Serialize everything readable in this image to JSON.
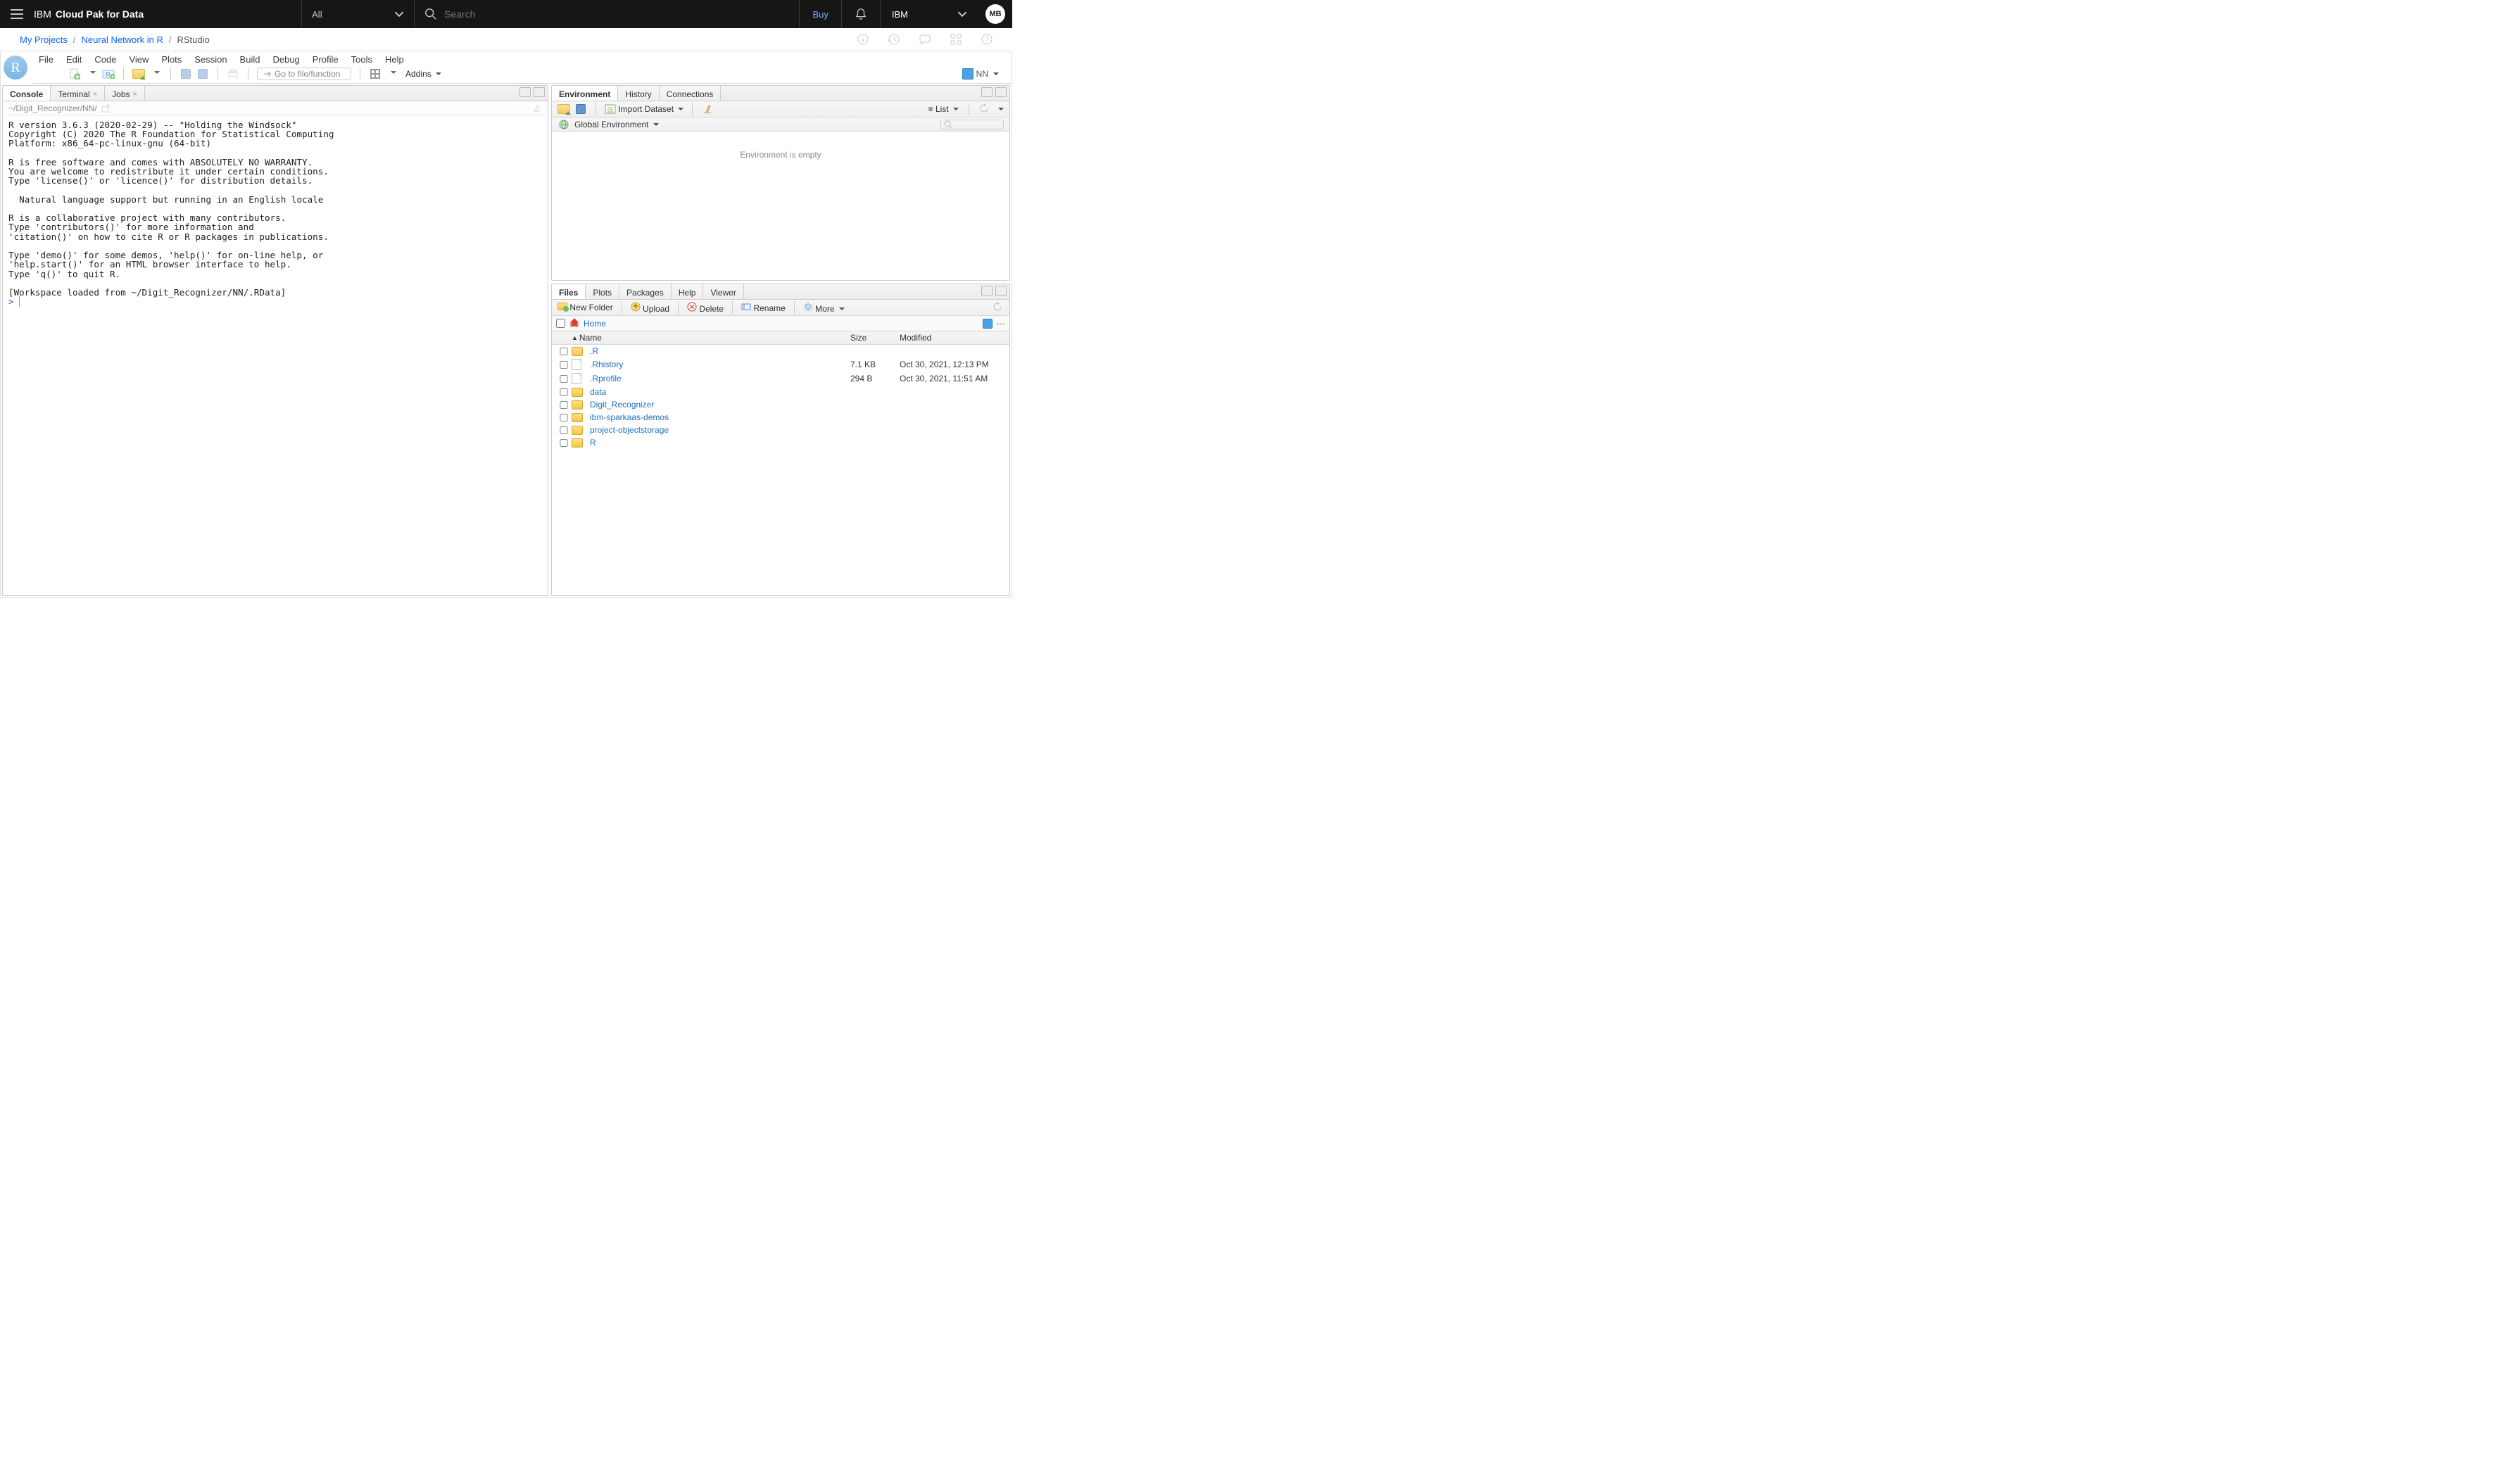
{
  "header": {
    "brand_prefix": "IBM",
    "brand_product": "Cloud Pak for Data",
    "filter": "All",
    "search_placeholder": "Search",
    "buy": "Buy",
    "account": "IBM",
    "avatar": "MB"
  },
  "breadcrumbs": {
    "items": [
      {
        "label": "My Projects",
        "link": true
      },
      {
        "label": "Neural Network in R",
        "link": true
      },
      {
        "label": "RStudio",
        "link": false
      }
    ]
  },
  "rstudio": {
    "menus": [
      "File",
      "Edit",
      "Code",
      "View",
      "Plots",
      "Session",
      "Build",
      "Debug",
      "Profile",
      "Tools",
      "Help"
    ],
    "goto_placeholder": "Go to file/function",
    "addins": "Addins",
    "project": "NN",
    "console": {
      "tab": "Console",
      "terminal_tab": "Terminal",
      "jobs_tab": "Jobs",
      "path": "~/Digit_Recognizer/NN/",
      "text": "R version 3.6.3 (2020-02-29) -- \"Holding the Windsock\"\nCopyright (C) 2020 The R Foundation for Statistical Computing\nPlatform: x86_64-pc-linux-gnu (64-bit)\n\nR is free software and comes with ABSOLUTELY NO WARRANTY.\nYou are welcome to redistribute it under certain conditions.\nType 'license()' or 'licence()' for distribution details.\n\n  Natural language support but running in an English locale\n\nR is a collaborative project with many contributors.\nType 'contributors()' for more information and\n'citation()' on how to cite R or R packages in publications.\n\nType 'demo()' for some demos, 'help()' for on-line help, or\n'help.start()' for an HTML browser interface to help.\nType 'q()' to quit R.\n\n[Workspace loaded from ~/Digit_Recognizer/NN/.RData]\n",
      "prompt": "> "
    },
    "env": {
      "tabs": [
        "Environment",
        "History",
        "Connections"
      ],
      "import": "Import Dataset",
      "scope": "Global Environment",
      "list": "List",
      "empty": "Environment is empty"
    },
    "files": {
      "tabs": [
        "Files",
        "Plots",
        "Packages",
        "Help",
        "Viewer"
      ],
      "tb_new": "New Folder",
      "tb_upload": "Upload",
      "tb_delete": "Delete",
      "tb_rename": "Rename",
      "tb_more": "More",
      "bc_home": "Home",
      "col_name": "Name",
      "col_size": "Size",
      "col_modified": "Modified",
      "rows": [
        {
          "name": ".R",
          "icon": "folder",
          "size": "",
          "modified": ""
        },
        {
          "name": ".Rhistory",
          "icon": "file",
          "size": "7.1 KB",
          "modified": "Oct 30, 2021, 12:13 PM"
        },
        {
          "name": ".Rprofile",
          "icon": "file",
          "size": "294 B",
          "modified": "Oct 30, 2021, 11:51 AM"
        },
        {
          "name": "data",
          "icon": "folder",
          "size": "",
          "modified": ""
        },
        {
          "name": "Digit_Recognizer",
          "icon": "folder",
          "size": "",
          "modified": ""
        },
        {
          "name": "ibm-sparkaas-demos",
          "icon": "folder",
          "size": "",
          "modified": ""
        },
        {
          "name": "project-objectstorage",
          "icon": "folder",
          "size": "",
          "modified": ""
        },
        {
          "name": "R",
          "icon": "folder",
          "size": "",
          "modified": ""
        }
      ]
    }
  }
}
